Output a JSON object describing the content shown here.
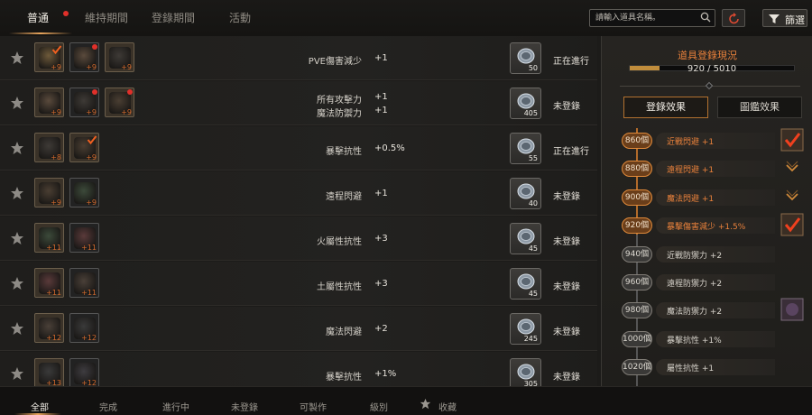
{
  "top_tabs": [
    "普通",
    "維持期間",
    "登錄期間",
    "活動"
  ],
  "search": {
    "placeholder": "請輸入道具名稱。"
  },
  "filter_label": "篩選",
  "rows": [
    {
      "stats": [
        {
          "name": "PVE傷害減少",
          "value": "+1"
        }
      ],
      "coin_count": "50",
      "status": "正在進行",
      "items": [
        {
          "enh": "+9",
          "checked": true
        },
        {
          "enh": "+9",
          "dot": true
        },
        {
          "enh": "+9"
        }
      ]
    },
    {
      "stats": [
        {
          "name": "所有攻擊力",
          "value": "+1"
        },
        {
          "name": "魔法防禦力",
          "value": "+1"
        }
      ],
      "coin_count": "405",
      "status": "未登錄",
      "items": [
        {
          "enh": "+9"
        },
        {
          "enh": "+9",
          "dot": true
        },
        {
          "enh": "+9",
          "dot": true
        }
      ]
    },
    {
      "stats": [
        {
          "name": "暴擊抗性",
          "value": "+0.5%"
        }
      ],
      "coin_count": "55",
      "status": "正在進行",
      "items": [
        {
          "enh": "+8"
        },
        {
          "enh": "+9",
          "checked": true
        }
      ]
    },
    {
      "stats": [
        {
          "name": "遠程閃避",
          "value": "+1"
        }
      ],
      "coin_count": "40",
      "status": "未登錄",
      "items": [
        {
          "enh": "+9"
        },
        {
          "enh": "+9"
        }
      ]
    },
    {
      "stats": [
        {
          "name": "火屬性抗性",
          "value": "+3"
        }
      ],
      "coin_count": "45",
      "status": "未登錄",
      "items": [
        {
          "enh": "+11"
        },
        {
          "enh": "+11"
        }
      ]
    },
    {
      "stats": [
        {
          "name": "土屬性抗性",
          "value": "+3"
        }
      ],
      "coin_count": "45",
      "status": "未登錄",
      "items": [
        {
          "enh": "+11"
        },
        {
          "enh": "+11"
        }
      ]
    },
    {
      "stats": [
        {
          "name": "魔法閃避",
          "value": "+2"
        }
      ],
      "coin_count": "245",
      "status": "未登錄",
      "items": [
        {
          "enh": "+12"
        },
        {
          "enh": "+12"
        }
      ]
    },
    {
      "stats": [
        {
          "name": "暴擊抗性",
          "value": "+1%"
        }
      ],
      "coin_count": "305",
      "status": "未登錄",
      "items": [
        {
          "enh": "+13"
        },
        {
          "enh": "+12"
        }
      ]
    }
  ],
  "panel": {
    "title": "道具登錄現況",
    "progress_text": "920 / 5010",
    "progress_fraction": 0.184,
    "tabs": [
      "登錄效果",
      "圖鑑效果"
    ],
    "tiers": [
      {
        "count": "860個",
        "label": "近戰閃避 +1",
        "unlocked": true,
        "mark": "check-box"
      },
      {
        "count": "880個",
        "label": "遠程閃避 +1",
        "unlocked": true,
        "mark": "chevron"
      },
      {
        "count": "900個",
        "label": "魔法閃避 +1",
        "unlocked": true,
        "mark": "chevron"
      },
      {
        "count": "920個",
        "label": "暴擊傷害減少 +1.5%",
        "unlocked": true,
        "mark": "check-box"
      },
      {
        "count": "940個",
        "label": "近戰防禦力 +2",
        "unlocked": false,
        "mark": ""
      },
      {
        "count": "960個",
        "label": "遠程防禦力 +2",
        "unlocked": false,
        "mark": ""
      },
      {
        "count": "980個",
        "label": "魔法防禦力 +2",
        "unlocked": false,
        "mark": "item"
      },
      {
        "count": "1000個",
        "label": "暴擊抗性 +1%",
        "unlocked": false,
        "mark": ""
      },
      {
        "count": "1020個",
        "label": "屬性抗性 +1",
        "unlocked": false,
        "mark": ""
      }
    ]
  },
  "bottom_tabs": [
    "全部",
    "完成",
    "進行中",
    "未登錄",
    "可製作",
    "級別",
    "收藏"
  ]
}
